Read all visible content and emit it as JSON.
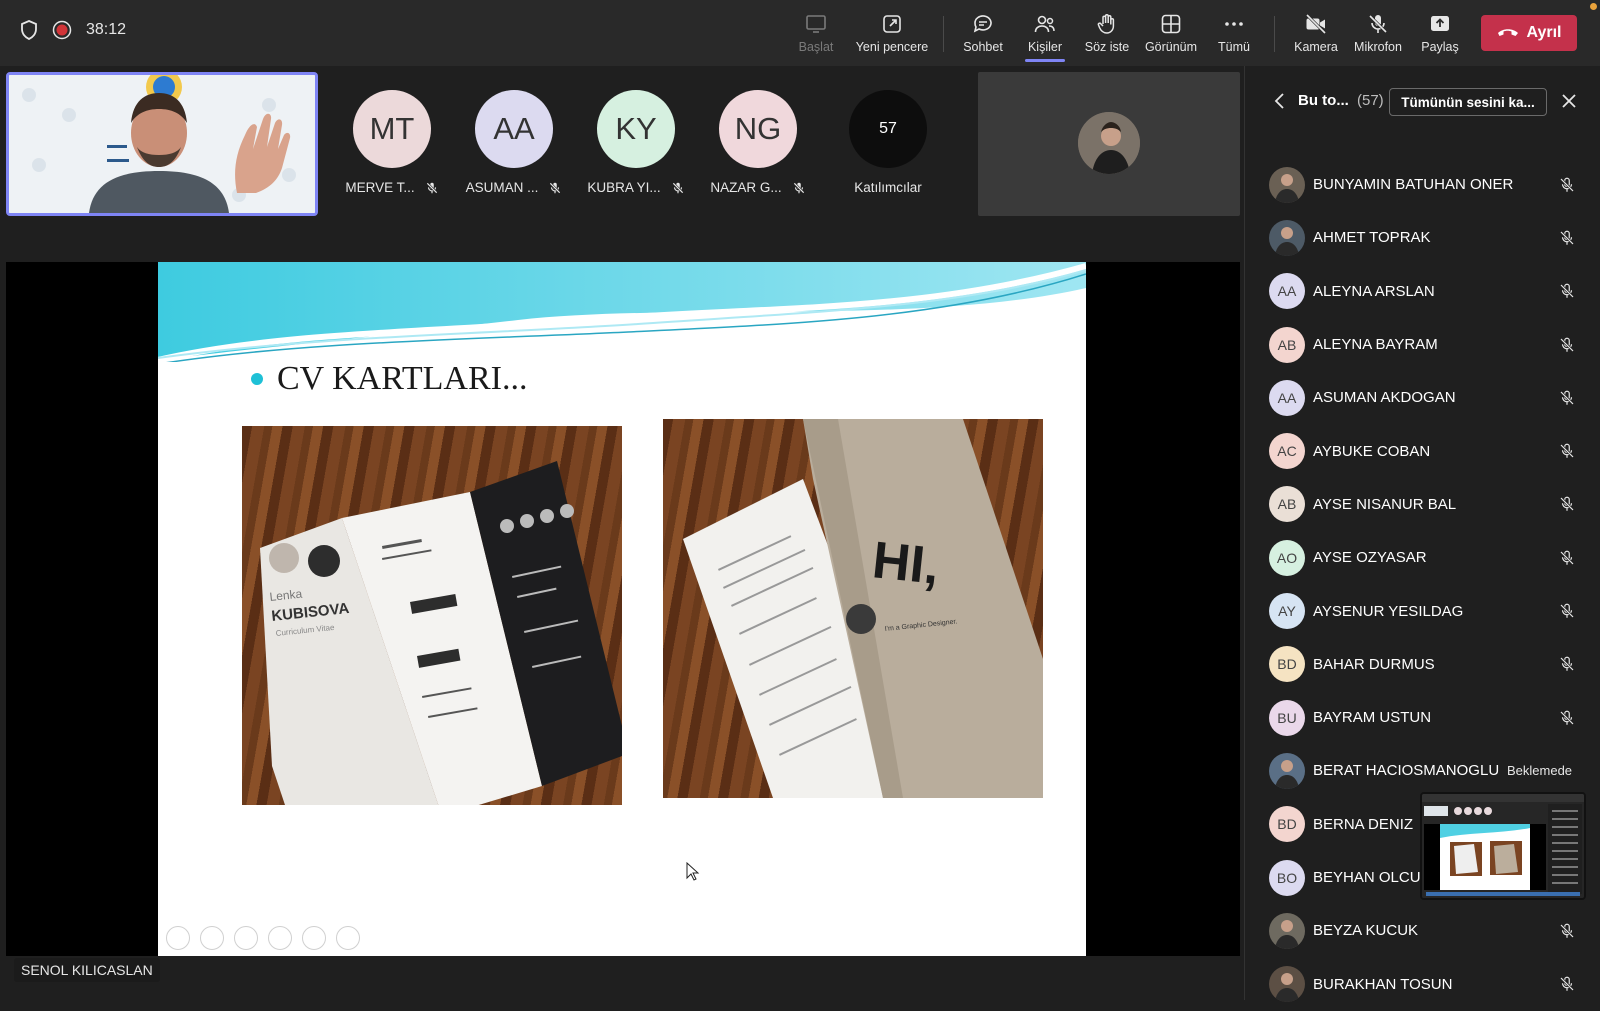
{
  "timer": "38:12",
  "toolbar": {
    "start_label": "Başlat",
    "new_window_label": "Yeni pencere",
    "chat_label": "Sohbet",
    "people_label": "Kişiler",
    "raise_hand_label": "Söz iste",
    "view_label": "Görünüm",
    "more_label": "Tümü",
    "camera_label": "Kamera",
    "mic_label": "Mikrofon",
    "share_label": "Paylaş",
    "leave_label": "Ayrıl"
  },
  "participants_strip": [
    {
      "initials": "MT",
      "name": "MERVE T...",
      "color": "#ecd9da"
    },
    {
      "initials": "AA",
      "name": "ASUMAN ...",
      "color": "#dcdaf0"
    },
    {
      "initials": "KY",
      "name": "KUBRA YI...",
      "color": "#d6f0e0"
    },
    {
      "initials": "NG",
      "name": "NAZAR G...",
      "color": "#f0d8dc"
    }
  ],
  "more_count": "57",
  "more_label": "Katılımcılar",
  "slide": {
    "title": "CV KARTLARI...",
    "cv_first": "Lenka",
    "cv_last": "KUBISOVA",
    "cv_sub": "Curriculum Vitae",
    "hi_text": "HI,",
    "hi_sub": "I'm a Graphic Designer."
  },
  "presenter_name": "SENOL KILICASLAN",
  "panel": {
    "title": "Bu to...",
    "count": "(57)",
    "mute_all": "Tümünün sesini ka..."
  },
  "people": [
    {
      "initials": "",
      "name": "BUNYAMIN BATUHAN ONER",
      "color": "#6a6054",
      "photo": true,
      "muted": true,
      "status": ""
    },
    {
      "initials": "",
      "name": "AHMET TOPRAK",
      "color": "#4d5a66",
      "photo": true,
      "muted": true,
      "status": ""
    },
    {
      "initials": "AA",
      "name": "ALEYNA ARSLAN",
      "color": "#dcdaf0",
      "photo": false,
      "muted": true,
      "status": ""
    },
    {
      "initials": "AB",
      "name": "ALEYNA BAYRAM",
      "color": "#f3d5cf",
      "photo": false,
      "muted": true,
      "status": ""
    },
    {
      "initials": "AA",
      "name": "ASUMAN AKDOGAN",
      "color": "#dcdaf0",
      "photo": false,
      "muted": true,
      "status": ""
    },
    {
      "initials": "AC",
      "name": "AYBUKE COBAN",
      "color": "#f3d5cf",
      "photo": false,
      "muted": true,
      "status": ""
    },
    {
      "initials": "AB",
      "name": "AYSE NISANUR BAL",
      "color": "#eadfd6",
      "photo": false,
      "muted": true,
      "status": ""
    },
    {
      "initials": "AO",
      "name": "AYSE OZYASAR",
      "color": "#d6f0e0",
      "photo": false,
      "muted": true,
      "status": ""
    },
    {
      "initials": "AY",
      "name": "AYSENUR YESILDAG",
      "color": "#d6e4f3",
      "photo": false,
      "muted": true,
      "status": ""
    },
    {
      "initials": "BD",
      "name": "BAHAR DURMUS",
      "color": "#f5e3c2",
      "photo": false,
      "muted": true,
      "status": ""
    },
    {
      "initials": "BU",
      "name": "BAYRAM USTUN",
      "color": "#ead8ea",
      "photo": false,
      "muted": true,
      "status": ""
    },
    {
      "initials": "",
      "name": "BERAT HACIOSMANOGLU",
      "color": "#5a6f86",
      "photo": true,
      "muted": false,
      "status": "Beklemede"
    },
    {
      "initials": "BD",
      "name": "BERNA DENIZ",
      "color": "#f3d5cf",
      "photo": false,
      "muted": false,
      "status": ""
    },
    {
      "initials": "BO",
      "name": "BEYHAN OLCU",
      "color": "#dcdaf0",
      "photo": false,
      "muted": false,
      "status": ""
    },
    {
      "initials": "",
      "name": "BEYZA KUCUK",
      "color": "#6e6a60",
      "photo": true,
      "muted": true,
      "status": ""
    },
    {
      "initials": "",
      "name": "BURAKHAN TOSUN",
      "color": "#5c4f44",
      "photo": true,
      "muted": true,
      "status": ""
    }
  ]
}
